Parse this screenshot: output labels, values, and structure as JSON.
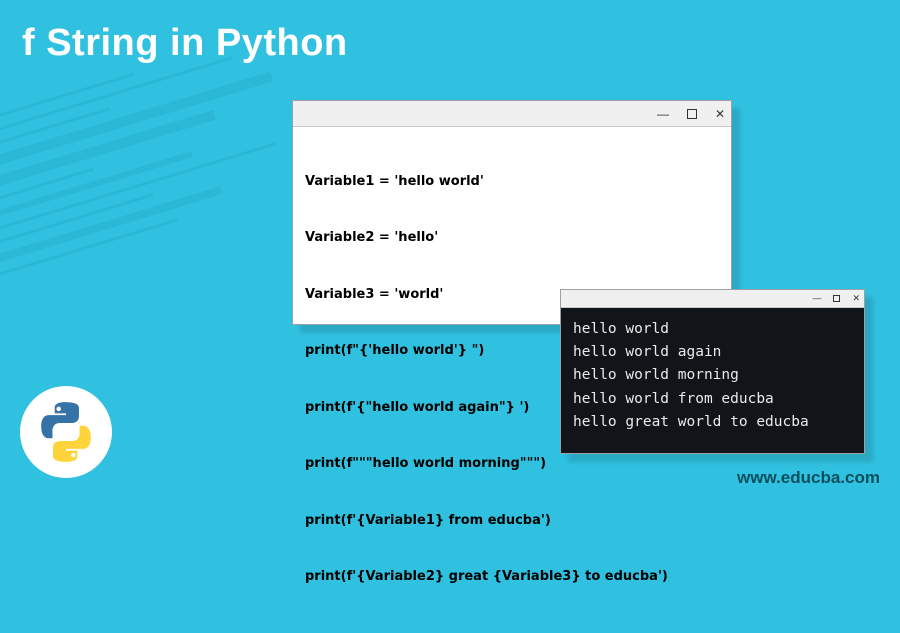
{
  "title": "f String in Python",
  "codeWindow": {
    "lines": [
      "Variable1 = 'hello world'",
      "Variable2 = 'hello'",
      "Variable3 = 'world'",
      "print(f\"{'hello world'} \")",
      "print(f'{\"hello world again\"} ')",
      "print(f\"\"\"hello world morning\"\"\")",
      "print(f'{Variable1} from educba')",
      "print(f'{Variable2} great {Variable3} to educba')"
    ]
  },
  "outputWindow": {
    "lines": [
      "hello world",
      "hello world again",
      "hello world morning",
      "hello world from educba",
      "hello great world to educba"
    ]
  },
  "footer": {
    "url": "www.educba.com",
    "logoAlt": "python-logo"
  },
  "icons": {
    "minimize": "—",
    "close": "✕"
  }
}
